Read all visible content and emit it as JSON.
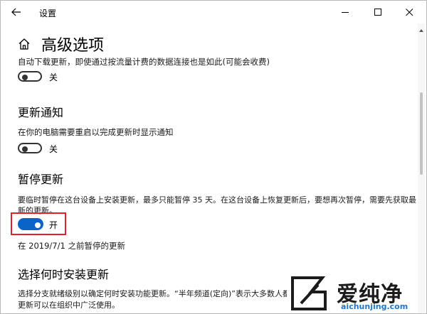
{
  "window": {
    "title": "设置"
  },
  "page": {
    "title": "高级选项"
  },
  "sections": {
    "metered": {
      "description": "自动下载更新，即使通过按流量计费的数据连接也是如此(可能会收费)",
      "toggle_state": "关",
      "toggle_on": false
    },
    "notify": {
      "heading": "更新通知",
      "description": "在你的电脑需要重启以完成更新时显示通知",
      "toggle_state": "关",
      "toggle_on": false
    },
    "pause": {
      "heading": "暂停更新",
      "description_line1": "要临时暂停在这台设备上安装更新，最多只能暂停 35 天。在这台设备上恢复更新后，要想再次暂停，需要先获取最",
      "description_line2": "新的更新。",
      "toggle_state": "开",
      "toggle_on": true,
      "pause_note": "在 2019/7/1 之前暂停的更新"
    },
    "choose_when": {
      "heading": "选择何时安装更新",
      "description_line1": "选择分支就绪级别以确定何时安装功能更新。“半年频道(定向)”表示大多数人都可",
      "description_line2": "更新可以在组织中广泛使用。"
    }
  },
  "watermark": {
    "name": "爱纯净",
    "url": "aichunjing.com"
  },
  "colors": {
    "toggle_on": "#0a64c8",
    "highlight": "#e0202a",
    "watermark_url": "#1e77c9"
  },
  "icons": [
    "back-arrow-icon",
    "minimize-icon",
    "maximize-icon",
    "close-icon",
    "home-icon",
    "scroll-up-icon"
  ]
}
